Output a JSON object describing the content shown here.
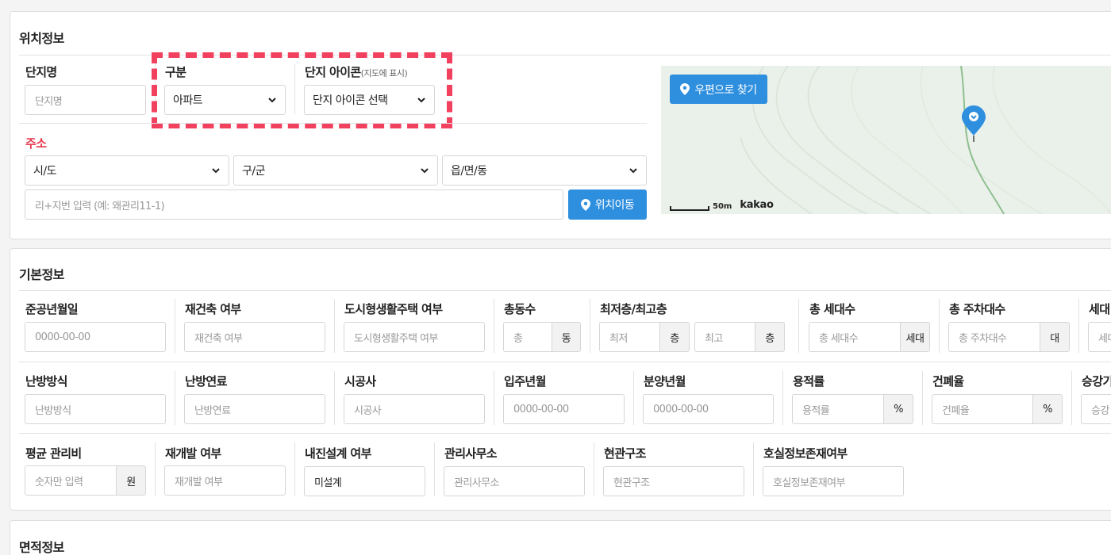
{
  "location": {
    "title": "위치정보",
    "complex_name": {
      "label": "단지명",
      "placeholder": "단지명"
    },
    "category": {
      "label": "구분",
      "value": "아파트"
    },
    "complex_icon": {
      "label": "단지 아이콘",
      "label_note": "(지도에 표시)",
      "value": "단지 아이콘 선택"
    },
    "address": {
      "label": "주소",
      "sido": "시/도",
      "gugun": "구/군",
      "dong": "읍/면/동",
      "detail_placeholder": "리+지번 입력 (예: 왜관리11-1)",
      "move_button": "위치이동"
    },
    "map": {
      "postcode_button": "우편으로 찾기",
      "scale_label": "50m",
      "brand": "kakao"
    }
  },
  "basic": {
    "title": "기본정보",
    "row1": {
      "completion": {
        "label": "준공년월일",
        "placeholder": "0000-00-00"
      },
      "rebuild": {
        "label": "재건축 여부",
        "placeholder": "재건축 여부"
      },
      "urban_housing": {
        "label": "도시형생활주택 여부",
        "placeholder": "도시형생활주택 여부"
      },
      "buildings": {
        "label": "총동수",
        "placeholder": "총",
        "unit": "동"
      },
      "floors": {
        "label": "최저층/최고층",
        "min_placeholder": "최저",
        "max_placeholder": "최고",
        "unit": "층"
      },
      "households": {
        "label": "총 세대수",
        "placeholder": "총 세대수",
        "unit": "세대"
      },
      "parking": {
        "label": "총 주차대수",
        "placeholder": "총 주차대수",
        "unit": "대"
      },
      "cut_label": "세대",
      "cut_placeholder": "세대"
    },
    "row2": {
      "heating": {
        "label": "난방방식",
        "placeholder": "난방방식"
      },
      "fuel": {
        "label": "난방연료",
        "placeholder": "난방연료"
      },
      "builder": {
        "label": "시공사",
        "placeholder": "시공사"
      },
      "move_in": {
        "label": "입주년월",
        "placeholder": "0000-00-00"
      },
      "sale": {
        "label": "분양년월",
        "placeholder": "0000-00-00"
      },
      "far": {
        "label": "용적률",
        "placeholder": "용적률",
        "unit": "%"
      },
      "bcr": {
        "label": "건폐율",
        "placeholder": "건폐율",
        "unit": "%"
      },
      "cut_label": "승강기",
      "cut_placeholder": "승강"
    },
    "row3": {
      "mgmt_fee": {
        "label": "평균 관리비",
        "placeholder": "숫자만 입력",
        "unit": "원"
      },
      "redevelop": {
        "label": "재개발 여부",
        "placeholder": "재개발 여부"
      },
      "seismic": {
        "label": "내진설계 여부",
        "value": "미설계"
      },
      "office": {
        "label": "관리사무소",
        "placeholder": "관리사무소"
      },
      "entrance": {
        "label": "현관구조",
        "placeholder": "현관구조"
      },
      "room_info": {
        "label": "호실정보존재여부",
        "placeholder": "호실정보존재여부"
      }
    }
  },
  "area": {
    "title": "면적정보"
  },
  "colors": {
    "accent": "#2f8fdf",
    "highlight": "#f2405f",
    "required": "#e8384f"
  }
}
